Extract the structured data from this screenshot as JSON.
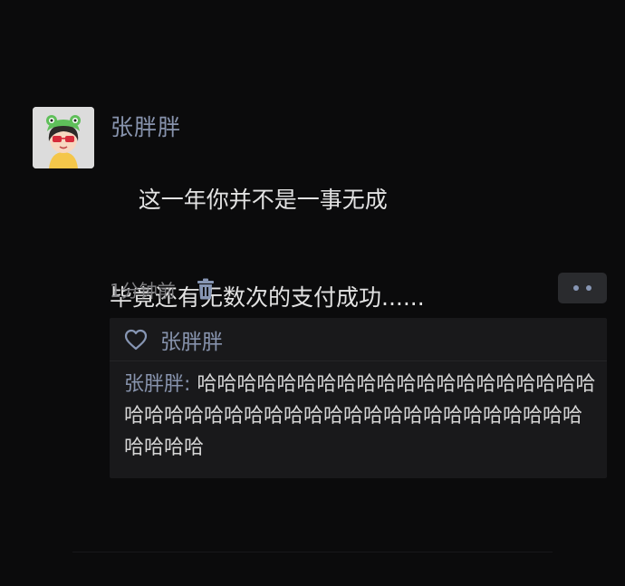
{
  "post": {
    "author": "张胖胖",
    "text_line1": "这一年你并不是一事无成",
    "text_line2": "毕竟还有无数次的支付成功......",
    "time": "1分钟前"
  },
  "likes": {
    "names": "张胖胖"
  },
  "comments": [
    {
      "author": "张胖胖",
      "separator": ": ",
      "text": "哈哈哈哈哈哈哈哈哈哈哈哈哈哈哈哈哈哈哈哈哈哈哈哈哈哈哈哈哈哈哈哈哈哈哈哈哈哈哈哈哈哈哈哈哈哈哈"
    }
  ],
  "colors": {
    "background": "#0b0b0c",
    "name_link": "#8793ad",
    "body_text": "#e2e2e2",
    "muted": "#7d7d80",
    "panel": "#19191b"
  },
  "icons": {
    "delete": "trash-icon",
    "like": "heart-icon",
    "more": "more-dots-icon"
  }
}
